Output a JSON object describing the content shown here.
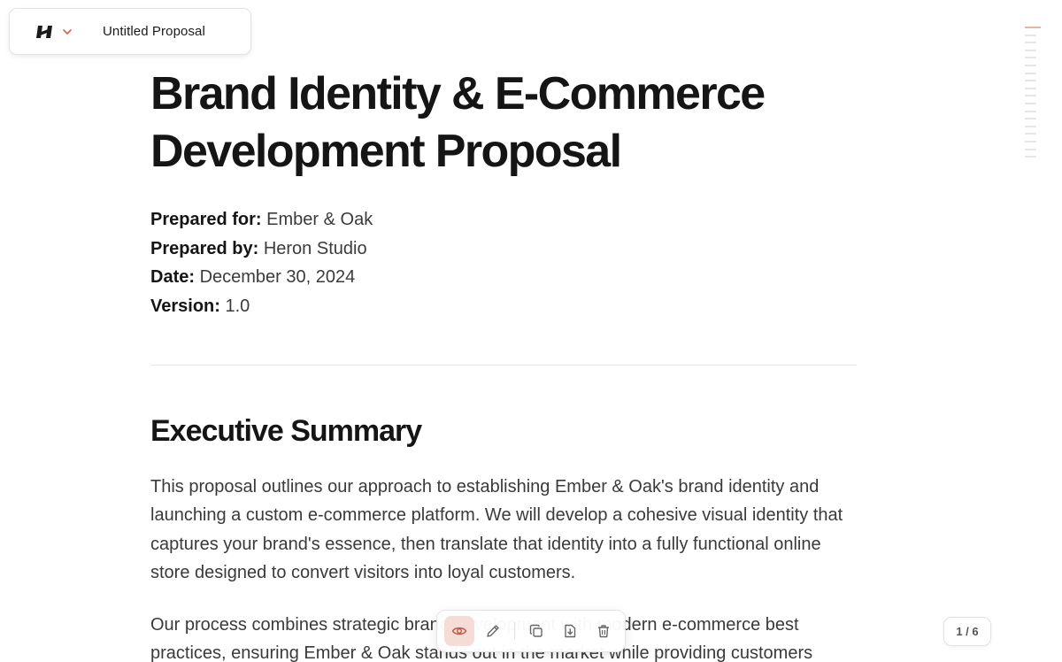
{
  "app": {
    "logo_icon": "heron-logo-icon",
    "menu_icon": "chevron-down-icon",
    "document_name": "Untitled Proposal",
    "accent_color": "#d9624a"
  },
  "document": {
    "title_line1": "Brand Identity & E-Commerce",
    "title_line2": "Development Proposal",
    "meta": [
      {
        "label": "Prepared for:",
        "value": "Ember & Oak"
      },
      {
        "label": "Prepared by:",
        "value": "Heron Studio"
      },
      {
        "label": "Date:",
        "value": "December 30, 2024"
      },
      {
        "label": "Version:",
        "value": "1.0"
      }
    ],
    "section_heading": "Executive Summary",
    "paragraph1": "This proposal outlines our approach to establishing Ember & Oak's brand identity and launching a custom e-commerce platform. We will develop a cohesive visual identity that captures your brand's essence, then translate that identity into a fully functional online store designed to convert visitors into loyal customers.",
    "paragraph2": "Our process combines strategic brand development with modern e-commerce best practices, ensuring Ember & Oak stands out in the market while providing customers"
  },
  "toolbar": {
    "buttons": [
      "eye-icon",
      "pencil-icon",
      "copy-icon",
      "download-icon",
      "trash-icon"
    ],
    "active_button": "eye-icon"
  },
  "pager": {
    "label": "1 / 6"
  }
}
